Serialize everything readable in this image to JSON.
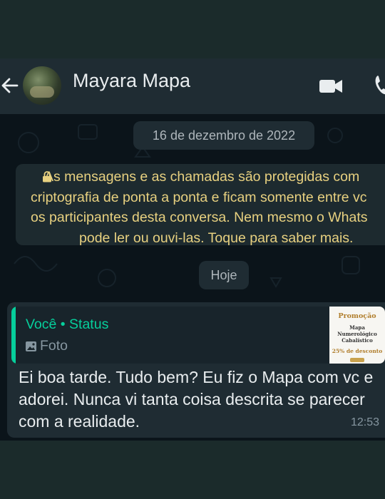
{
  "header": {
    "contact_name": "Mayara Mapa",
    "back_icon": "arrow-left-icon",
    "video_icon": "video-camera-icon",
    "call_icon": "phone-icon"
  },
  "chat": {
    "date_chip": "16 de dezembro de 2022",
    "encryption_notice": {
      "lines": [
        "As mensagens e as chamadas são protegidas com",
        "criptografia de ponta a ponta e ficam somente entre vc",
        "os participantes desta conversa. Nem mesmo o Whats",
        "pode ler ou ouvi-las. Toque para saber mais."
      ],
      "icon": "lock-icon"
    },
    "today_chip": "Hoje",
    "message": {
      "quote_title": "Você • Status",
      "quote_kind": "Foto",
      "quote_icon": "photo-icon",
      "thumbnail": {
        "line1": "Promoção",
        "line2": "Mapa Numerológico Cabalístico",
        "line3": "25% de desconto"
      },
      "text": "Ei boa tarde. Tudo bem? Eu fiz o Mapa com vc e adorei. Nunca vi tanta coisa descrita se parecer com a realidade.",
      "time": "12:53"
    }
  },
  "colors": {
    "header_bg": "#1f2c33",
    "chat_bg": "#0b141a",
    "bubble_bg": "#1f2c33",
    "accent_green": "#06cf9c",
    "encryption_text": "#e8d180",
    "primary_text": "#e9edef",
    "muted_text": "#8696a0"
  }
}
